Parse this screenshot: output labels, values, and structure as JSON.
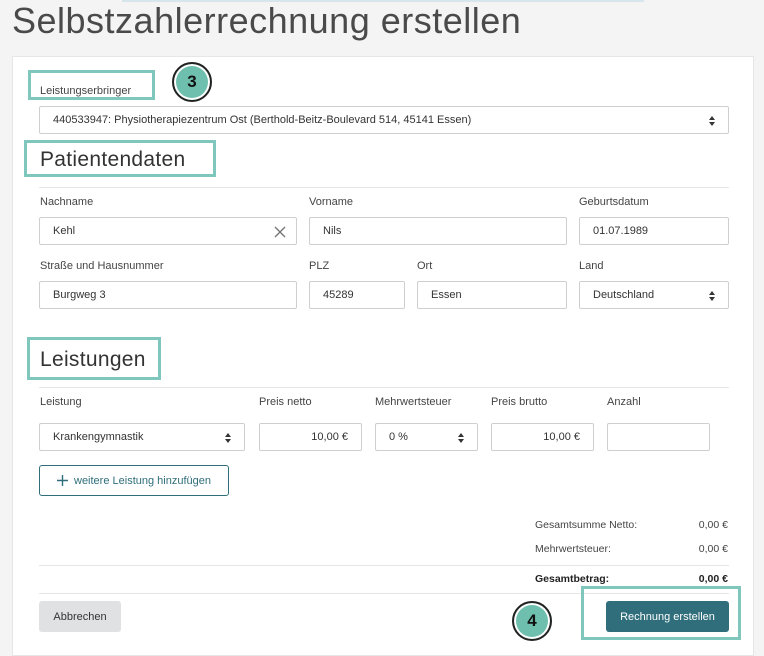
{
  "page": {
    "title": "Selbstzahlerrechnung erstellen"
  },
  "provider": {
    "label": "Leistungserbringer",
    "value": "440533947: Physiotherapiezentrum Ost (Berthold-Beitz-Boulevard 514, 45141 Essen)"
  },
  "patient": {
    "title": "Patientendaten",
    "lastname": {
      "label": "Nachname",
      "value": "Kehl"
    },
    "firstname": {
      "label": "Vorname",
      "value": "Nils"
    },
    "birthdate": {
      "label": "Geburtsdatum",
      "value": "01.07.1989"
    },
    "street": {
      "label": "Straße und Hausnummer",
      "value": "Burgweg 3"
    },
    "zip": {
      "label": "PLZ",
      "value": "45289"
    },
    "city": {
      "label": "Ort",
      "value": "Essen"
    },
    "country": {
      "label": "Land",
      "value": "Deutschland"
    }
  },
  "services": {
    "title": "Leistungen",
    "headers": {
      "service": "Leistung",
      "net": "Preis netto",
      "vat": "Mehrwertsteuer",
      "gross": "Preis brutto",
      "count": "Anzahl"
    },
    "rows": [
      {
        "service": "Krankengymnastik",
        "net": "10,00 €",
        "vat": "0 %",
        "gross": "10,00 €",
        "count": ""
      }
    ],
    "add_label": "weitere Leistung hinzufügen"
  },
  "totals": {
    "net_label": "Gesamtsumme Netto:",
    "net_value": "0,00 €",
    "vat_label": "Mehrwertsteuer:",
    "vat_value": "0,00 €",
    "total_label": "Gesamtbetrag:",
    "total_value": "0,00 €"
  },
  "actions": {
    "cancel": "Abbrechen",
    "submit": "Rechnung erstellen"
  },
  "annotations": {
    "badge_3": "3",
    "badge_4": "4"
  },
  "colors": {
    "primary": "#2f6e7a",
    "highlight": "#7fc7bd",
    "badge": "#6fbfae"
  }
}
